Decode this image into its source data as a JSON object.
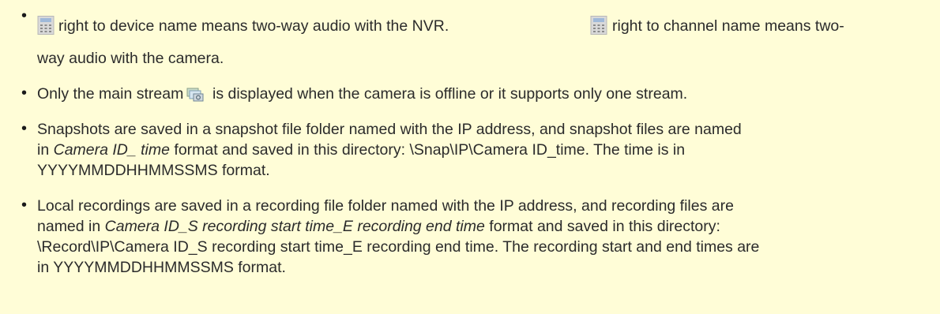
{
  "notes": {
    "item1": {
      "segment1": "right to device name means two-way audio with the NVR.",
      "segment2": "right to channel name means two-",
      "line2": "way audio with the camera.",
      "icon": "intercom-icon"
    },
    "item2": {
      "before_icon": "Only the main stream",
      "after_icon": "is displayed when the camera is offline or it supports only one stream.",
      "icon": "main-stream-icon"
    },
    "item3": {
      "line1": "Snapshots are saved in a snapshot file folder named with the IP address, and snapshot files are named",
      "line2_prefix": "in ",
      "line2_italic": "Camera ID_ time",
      "line2_suffix": " format and saved in this directory: \\Snap\\IP\\Camera ID_time. The time is in",
      "line3": "YYYYMMDDHHMMSSMS format."
    },
    "item4": {
      "line1": "Local recordings are saved in a recording file folder named with the IP address, and recording files are",
      "line2_prefix": "named in ",
      "line2_italic": "Camera ID_S recording start time_E recording end time",
      "line2_suffix": " format and saved in this directory:",
      "line3": "\\Record\\IP\\Camera ID_S recording start time_E recording end time. The recording start and end times are",
      "line4": "in YYYYMMDDHHMMSSMS format."
    }
  },
  "colors": {
    "background": "#fffdd7",
    "text": "#2b2b2b"
  }
}
